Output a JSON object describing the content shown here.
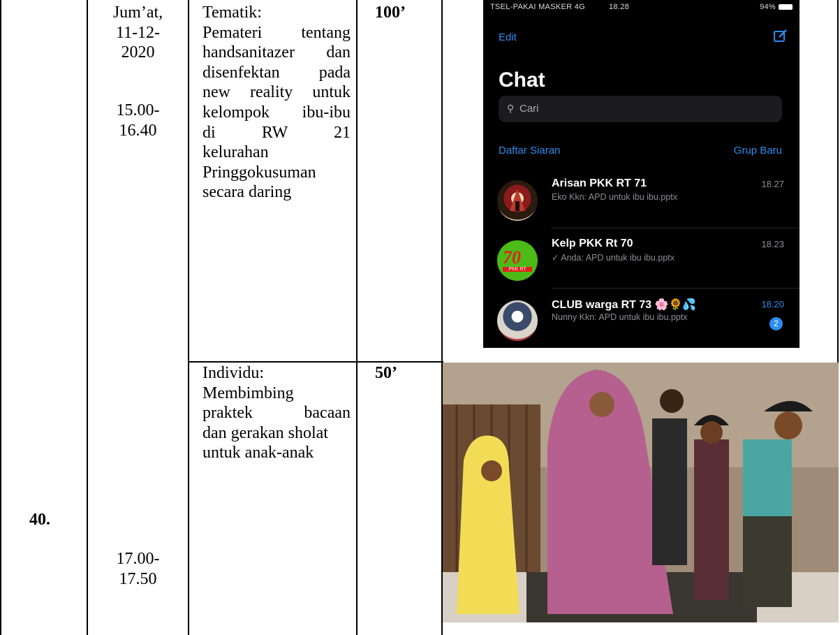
{
  "row": {
    "number": "40.",
    "date_lines": [
      "Jum’at,",
      "11-12-",
      "2020"
    ],
    "time1_lines": [
      "15.00-",
      "16.40"
    ],
    "time2_lines": [
      "17.00-",
      "17.50"
    ]
  },
  "activities": [
    {
      "label": "Tematik",
      "colon": ":",
      "lines": [
        "Pemateri tentang",
        "handsanitazer dan",
        "disenfektan pada",
        "new reality untuk",
        "kelompok ibu-ibu",
        "di RW 21",
        "kelurahan",
        "Pringgokusuman",
        "secara daring"
      ],
      "duration": "100’"
    },
    {
      "label": "Individu",
      "colon": ":",
      "lines": [
        "Membimbing",
        "praktek bacaan",
        "dan gerakan sholat",
        "untuk anak-anak"
      ],
      "duration": "50’"
    }
  ],
  "phone": {
    "status_left": "TSEL-PAKAI MASKER  4G",
    "status_time": "18.28",
    "status_right": "94%",
    "edit": "Edit",
    "title": "Chat",
    "search_placeholder": "Cari",
    "broadcast_link": "Daftar Siaran",
    "new_group_link": "Grup Baru",
    "chats": [
      {
        "name": "Arisan PKK RT 71",
        "preview": "Eko Kkn: APD untuk ibu ibu.pptx",
        "time": "18.27"
      },
      {
        "name": "Kelp PKK Rt 70",
        "preview": "✓ Anda: APD untuk ibu ibu.pptx",
        "time": "18.23",
        "avatar_text": "70",
        "avatar_sub": "PKK RT"
      },
      {
        "name": "CLUB warga RT 73 🌸🌻💦",
        "preview": "Nunny Kkn: APD untuk ibu ibu.pptx",
        "time": "18.20",
        "badge": "2"
      }
    ],
    "colors": {
      "accent": "#2b8df0",
      "background": "#000000"
    },
    "icons": [
      "compose-icon",
      "search-icon",
      "file-icon"
    ]
  }
}
